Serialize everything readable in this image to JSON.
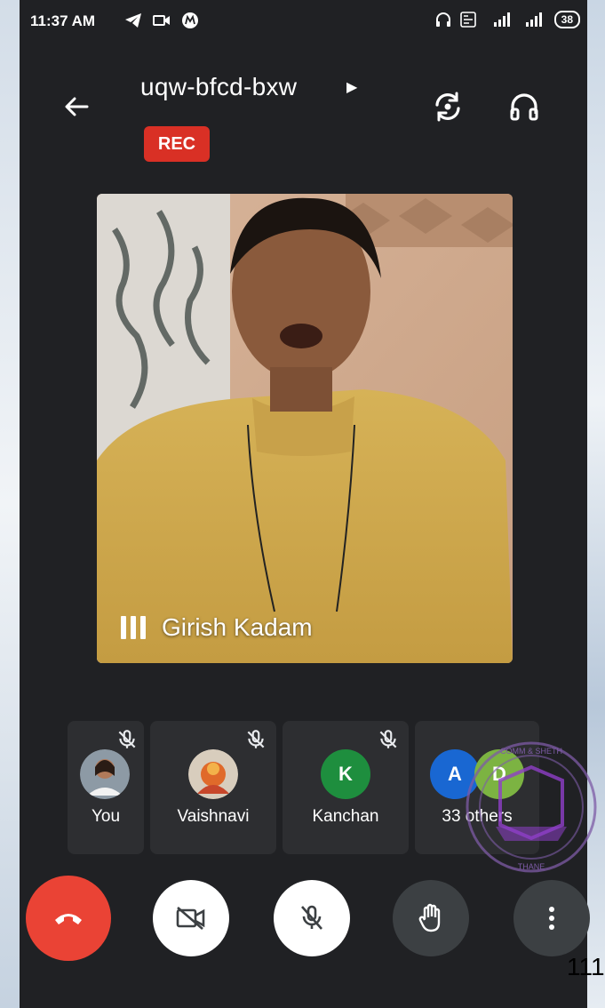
{
  "status_bar": {
    "time": "11:37 AM",
    "battery": "38"
  },
  "meeting": {
    "code": "uqw-bfcd-bxw",
    "recording_badge": "REC"
  },
  "main_tile": {
    "speaker_name": "Girish Kadam"
  },
  "participants": [
    {
      "name": "You",
      "muted": true
    },
    {
      "name": "Vaishnavi",
      "muted": true
    },
    {
      "name": "Kanchan",
      "initial": "K",
      "avatar_color": "#1e8e3e",
      "muted": true
    },
    {
      "name": "33 others",
      "initials": [
        "A",
        "D"
      ],
      "avatar_colors": [
        "#1967d2",
        "#7cb342"
      ]
    }
  ],
  "controls": [
    "end-call",
    "camera-off",
    "mic-off",
    "raise-hand",
    "more-options"
  ],
  "colors": {
    "end_call": "#ea4335",
    "rec_badge": "#d93025",
    "background": "#202124"
  },
  "page_number": "111"
}
